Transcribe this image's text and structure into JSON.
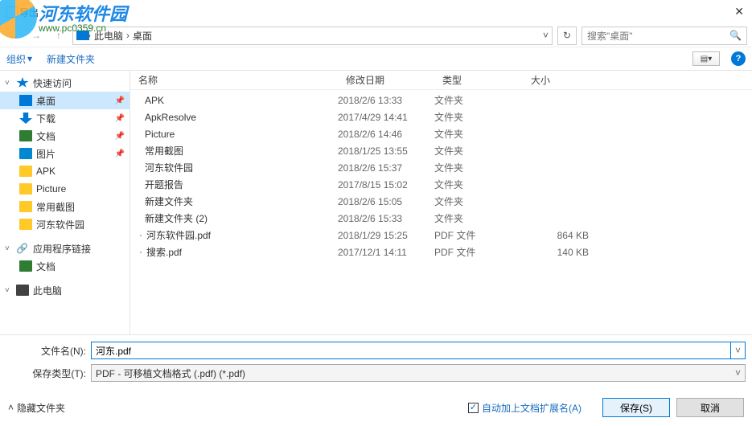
{
  "window": {
    "title": "导出",
    "close_glyph": "✕"
  },
  "watermark": {
    "cn": "河东软件园",
    "url": "www.pc0359.cn"
  },
  "breadcrumb": {
    "loc1": "此电脑",
    "loc2": "桌面"
  },
  "search": {
    "placeholder": "搜索\"桌面\"",
    "mag": "🔍"
  },
  "toolbar": {
    "organize": "组织",
    "newfolder": "新建文件夹",
    "view_glyph": "▤",
    "help_glyph": "?"
  },
  "sidebar": {
    "quick": "快速访问",
    "desktop": "桌面",
    "downloads": "下载",
    "documents": "文档",
    "pictures": "图片",
    "apk": "APK",
    "picture_en": "Picture",
    "screenshots": "常用截图",
    "hedong": "河东软件园",
    "applinks": "应用程序链接",
    "applinks_docs": "文档",
    "thispc": "此电脑"
  },
  "columns": {
    "name": "名称",
    "date": "修改日期",
    "type": "类型",
    "size": "大小"
  },
  "files": [
    {
      "name": "APK",
      "date": "2018/2/6 13:33",
      "type": "文件夹",
      "size": "",
      "icon": "folder"
    },
    {
      "name": "ApkResolve",
      "date": "2017/4/29 14:41",
      "type": "文件夹",
      "size": "",
      "icon": "folder"
    },
    {
      "name": "Picture",
      "date": "2018/2/6 14:46",
      "type": "文件夹",
      "size": "",
      "icon": "folder"
    },
    {
      "name": "常用截图",
      "date": "2018/1/25 13:55",
      "type": "文件夹",
      "size": "",
      "icon": "folder"
    },
    {
      "name": "河东软件园",
      "date": "2018/2/6 15:37",
      "type": "文件夹",
      "size": "",
      "icon": "folder"
    },
    {
      "name": "开题报告",
      "date": "2017/8/15 15:02",
      "type": "文件夹",
      "size": "",
      "icon": "folder"
    },
    {
      "name": "新建文件夹",
      "date": "2018/2/6 15:05",
      "type": "文件夹",
      "size": "",
      "icon": "folder"
    },
    {
      "name": "新建文件夹 (2)",
      "date": "2018/2/6 15:33",
      "type": "文件夹",
      "size": "",
      "icon": "folder"
    },
    {
      "name": "河东软件园.pdf",
      "date": "2018/1/29 15:25",
      "type": "PDF 文件",
      "size": "864 KB",
      "icon": "pdf"
    },
    {
      "name": "搜索.pdf",
      "date": "2017/12/1 14:11",
      "type": "PDF 文件",
      "size": "140 KB",
      "icon": "pdf"
    }
  ],
  "filename_label": "文件名(N):",
  "filename_value": "河东.pdf",
  "filetype_label": "保存类型(T):",
  "filetype_value": "PDF - 可移植文档格式 (.pdf) (*.pdf)",
  "footer": {
    "hide_folders": "隐藏文件夹",
    "auto_ext": "自动加上文档扩展名(A)",
    "save": "保存(S)",
    "cancel": "取消"
  },
  "glyph": {
    "down": "▾",
    "right": "›",
    "up": "˄",
    "collapse": "˅"
  }
}
